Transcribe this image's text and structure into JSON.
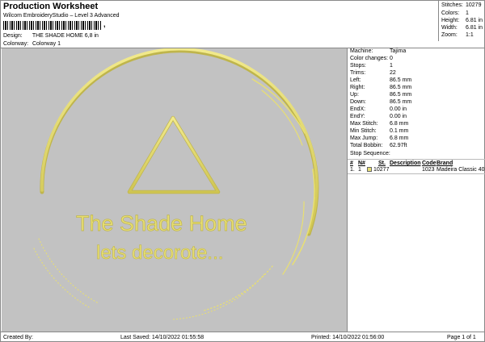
{
  "header": {
    "title": "Production Worksheet",
    "subtitle": "Wilcom EmbroideryStudio – Level 3 Advanced",
    "barcode_suffix": ","
  },
  "design": {
    "label": "Design:",
    "value": "THE SHADE HOME 6,8 in"
  },
  "colorway": {
    "label": "Colorway:",
    "value": "Colorway 1"
  },
  "stats": [
    {
      "label": "Stitches:",
      "value": "10279"
    },
    {
      "label": "Colors:",
      "value": "1"
    },
    {
      "label": "Height:",
      "value": "6.81 in"
    },
    {
      "label": "Width:",
      "value": "6.81 in"
    },
    {
      "label": "Zoom:",
      "value": "1:1"
    }
  ],
  "machine_info": [
    {
      "label": "Machine:",
      "value": "Tajima"
    },
    {
      "label": "Color changes:",
      "value": "0"
    },
    {
      "label": "Stops:",
      "value": "1"
    },
    {
      "label": "Trims:",
      "value": "22"
    },
    {
      "label": "Left:",
      "value": "86.5 mm"
    },
    {
      "label": "Right:",
      "value": "86.5 mm"
    },
    {
      "label": "Up:",
      "value": "86.5 mm"
    },
    {
      "label": "Down:",
      "value": "86.5 mm"
    },
    {
      "label": "EndX:",
      "value": "0.00 in"
    },
    {
      "label": "EndY:",
      "value": "0.00 in"
    },
    {
      "label": "Max Stitch:",
      "value": "6.8 mm"
    },
    {
      "label": "Min Stitch:",
      "value": "0.1 mm"
    },
    {
      "label": "Max Jump:",
      "value": "6.8 mm"
    },
    {
      "label": "Total Bobbin:",
      "value": "62.97ft"
    }
  ],
  "stop_sequence": {
    "title": "Stop Sequence:",
    "headers": {
      "num": "#",
      "n": "N#",
      "st": "St.",
      "description": "Description",
      "code": "Code",
      "brand": "Brand"
    },
    "rows": [
      {
        "num": "1.",
        "n": "1",
        "st": "10277",
        "description": "",
        "code": "1023",
        "brand": "Madeira Classic 40"
      }
    ]
  },
  "preview": {
    "line1": "The Shade Home",
    "line2": "lets decorote...",
    "thread_color": "#e8df73",
    "background": "#c2c2c2"
  },
  "footer": {
    "created_by": "Created By:",
    "last_saved": "Last Saved: 14/10/2022 01:55:58",
    "printed": "Printed: 14/10/2022 01:56:00",
    "page": "Page 1 of 1"
  }
}
